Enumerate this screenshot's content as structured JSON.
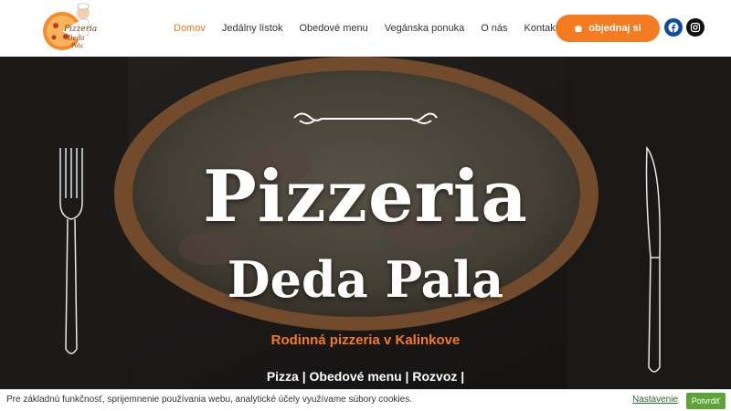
{
  "brand": {
    "logo_text_1": "Pizzeria",
    "logo_text_2": "Deda",
    "logo_text_3": "Pala"
  },
  "nav": {
    "items": [
      {
        "label": "Domov",
        "active": true
      },
      {
        "label": "Jedálny lístok",
        "active": false
      },
      {
        "label": "Obedové menu",
        "active": false
      },
      {
        "label": "Vegánska ponuka",
        "active": false
      },
      {
        "label": "O nás",
        "active": false
      },
      {
        "label": "Kontakt",
        "active": false
      }
    ]
  },
  "header": {
    "order_label": "objednaj si",
    "order_icon": "takeout-icon",
    "social": [
      {
        "name": "facebook-icon",
        "color": "#0d4da1"
      },
      {
        "name": "instagram-icon",
        "color": "#111111"
      }
    ]
  },
  "hero": {
    "title": "Pizzeria",
    "title2": "Deda Pala",
    "subtitle": "Rodinná pizzeria v Kalinkove",
    "services": "Pizza | Obedové menu | Rozvoz |"
  },
  "cookie": {
    "text": "Pre základnú funkčnosť, sprijemnenie používania webu, analytické účely využívame súbory cookies.",
    "settings_label": "Nastavenie",
    "confirm_label": "Potvrdiť"
  },
  "colors": {
    "accent": "#f47b20",
    "accept": "#5da33a"
  }
}
